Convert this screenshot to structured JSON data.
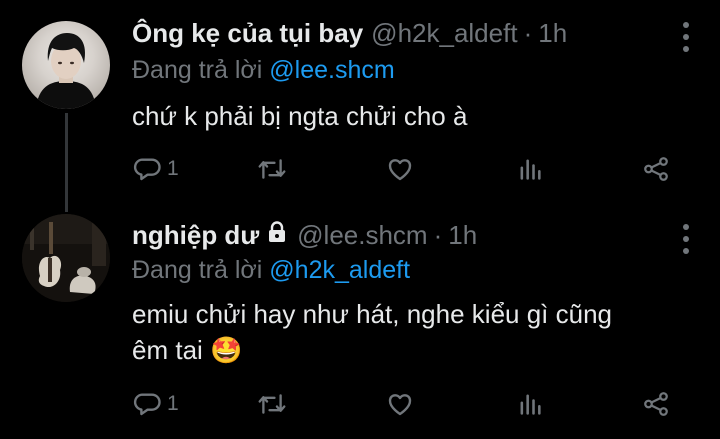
{
  "reply_prefix": "Đang trả lời",
  "tweets": [
    {
      "display_name": "Ông kẹ của tụi bay",
      "handle": "@h2k_aldeft",
      "dot": "·",
      "time": "1h",
      "reply_to": "@lee.shcm",
      "text": "chứ k phải bị ngta chửi cho à",
      "reply_count": "1",
      "protected": false
    },
    {
      "display_name": "nghiệp dư",
      "handle": "@lee.shcm",
      "dot": "·",
      "time": "1h",
      "reply_to": "@h2k_aldeft",
      "text_line1": "emiu chửi hay như hát, nghe kiểu gì cũng",
      "text_line2": "êm tai 🤩",
      "reply_count": "1",
      "protected": true
    }
  ],
  "icons": [
    "reply-icon",
    "retweet-icon",
    "like-icon",
    "views-icon",
    "share-icon",
    "more-icon",
    "lock-icon"
  ],
  "colors": {
    "background": "#000000",
    "text": "#e7e9ea",
    "secondary": "#71767b",
    "mention": "#1d9bf0",
    "thread_line": "#333639"
  }
}
